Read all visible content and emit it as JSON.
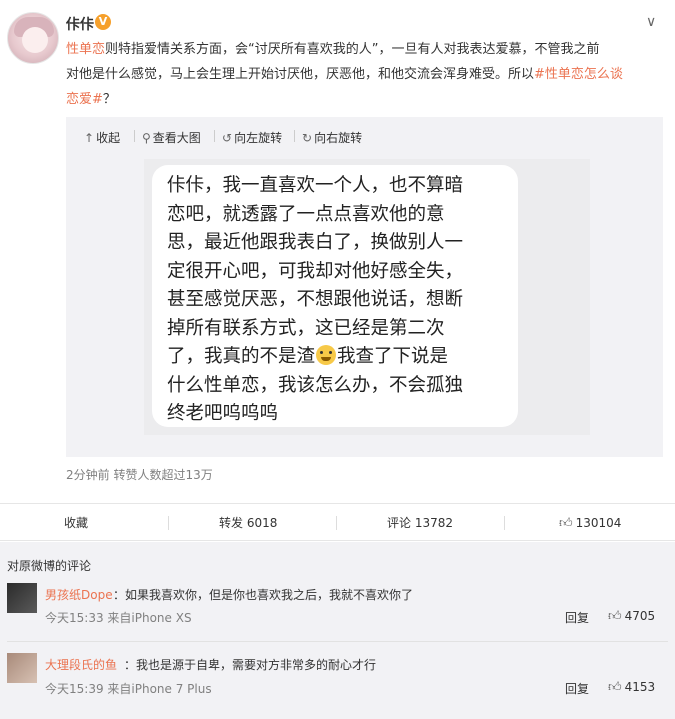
{
  "post": {
    "username": "佧佧",
    "verified_badge": "V",
    "menu_icon": "chevron-down-icon",
    "text_lines": [
      {
        "parts": [
          {
            "t": "性单恋",
            "link": true
          },
          {
            "t": "则特指爱情关系方面，会“讨厌所有喜欢我的人”，一旦有人对我表达爱慕，不管我之前",
            "link": false
          }
        ]
      },
      {
        "parts": [
          {
            "t": "对他是什么感觉，马上会生理上开始讨厌他，厌恶他，和他交流会浑身难受。所以",
            "link": false
          },
          {
            "t": "#性单恋怎么谈",
            "link": true
          }
        ]
      },
      {
        "parts": [
          {
            "t": "恋爱#",
            "link": true
          },
          {
            "t": "？",
            "link": false
          }
        ]
      }
    ],
    "meta": "2分钟前 转赞人数超过13万"
  },
  "media_toolbar": {
    "collapse": "收起",
    "view_large": "查看大图",
    "rotate_left": "向左旋转",
    "rotate_right": "向右旋转"
  },
  "chat_image": {
    "lines": [
      "佧佧，我一直喜欢一个人，也不算暗",
      "恋吧，就透露了一点点喜欢他的意",
      "思，最近他跟我表白了，换做别人一",
      "定很开心吧，可我却对他好感全失，",
      "甚至感觉厌恶，不想跟他说话，想断",
      "掉所有联系方式，这已经是第二次",
      "了，我真的不是渣",
      "我查了下说是",
      "什么性单恋，我该怎么办，不会孤独",
      "终老吧呜呜呜"
    ],
    "emoji_name": "crying-emoji"
  },
  "actions": {
    "favorite": "收藏",
    "repost": "转发 6018",
    "comment": "评论 13782",
    "like": "130104"
  },
  "comments": {
    "title": "对原微博的评论",
    "items": [
      {
        "name": "男孩纸Dope",
        "text": "：如果我喜欢你，但是你也喜欢我之后，我就不喜欢你了",
        "time": "今天15:33 来自iPhone XS",
        "reply": "回复",
        "likes": "4705"
      },
      {
        "name": "大理段氏的鱼",
        "text": "：我也是源于自卑，需要对方非常多的耐心才行",
        "time": "今天15:39 来自iPhone 7 Plus",
        "reply": "回复",
        "likes": "4153"
      }
    ]
  }
}
